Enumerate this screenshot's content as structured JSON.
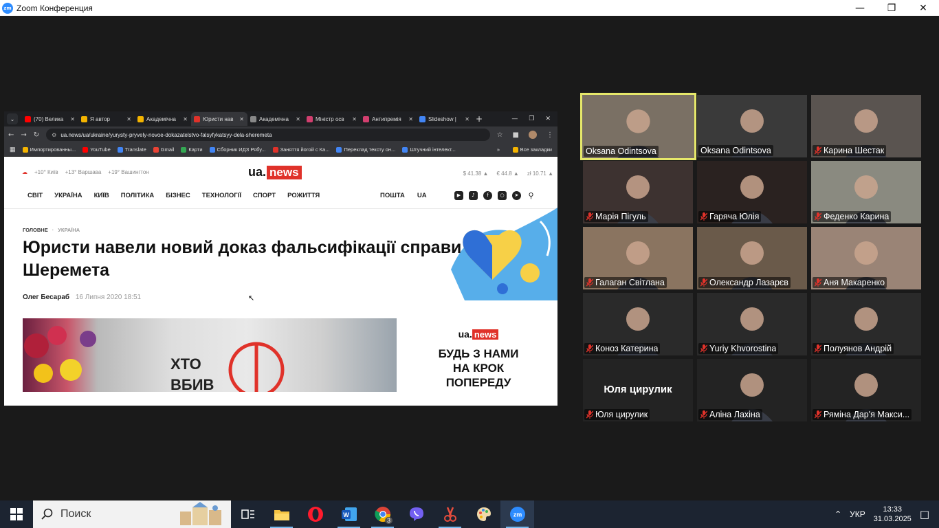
{
  "window": {
    "title": "Zoom Конференция",
    "logo_text": "zm"
  },
  "browser": {
    "tabs": [
      {
        "label": "(70) Велика",
        "color": "#ff0000"
      },
      {
        "label": "Я автор",
        "color": "#f4b400"
      },
      {
        "label": "Академічна",
        "color": "#f4b400"
      },
      {
        "label": "Юристи нав",
        "color": "#e0322a",
        "active": true
      },
      {
        "label": "Академічна",
        "color": "#888888"
      },
      {
        "label": "Міністр осв",
        "color": "#d23f6f"
      },
      {
        "label": "Антипремія",
        "color": "#d23f6f"
      },
      {
        "label": "Slideshow |",
        "color": "#4285f4"
      }
    ],
    "new_tab": "+",
    "url": "ua.news/ua/ukraine/yurysty-pryvely-novoe-dokazatelstvo-falsyfykatsyy-dela-sheremeta",
    "bookmarks": [
      {
        "label": "Импортированны...",
        "color": "#f4b400"
      },
      {
        "label": "YouTube",
        "color": "#ff0000"
      },
      {
        "label": "Translate",
        "color": "#4285f4"
      },
      {
        "label": "Gmail",
        "color": "#ea4335"
      },
      {
        "label": "Карти",
        "color": "#34a853"
      },
      {
        "label": "Сборник ИДЗ Рябу...",
        "color": "#4285f4"
      },
      {
        "label": "Заняття йогой с Ка...",
        "color": "#e0322a"
      },
      {
        "label": "Переклад тексту он...",
        "color": "#4285f4"
      },
      {
        "label": "Штучний інтелект...",
        "color": "#4285f4"
      }
    ],
    "bookmarks_more": "»",
    "all_bookmarks": "Все закладки"
  },
  "site": {
    "weather": [
      "+10° Київ",
      "+13° Варшава",
      "+19° Вашингтон"
    ],
    "logo_ua": "ua.",
    "logo_news": "news",
    "rates": [
      "$ 41.38 ▲",
      "€ 44.8 ▲",
      "zł 10.71 ▲"
    ],
    "nav": [
      "СВІТ",
      "УКРАЇНА",
      "КИЇВ",
      "ПОЛІТИКА",
      "БІЗНЕС",
      "ТЕХНОЛОГІЇ",
      "СПОРТ",
      "РОЖИТТЯ"
    ],
    "nav_right": [
      "ПОШТА",
      "UA"
    ],
    "social": [
      "youtube-icon",
      "tiktok-icon",
      "facebook-icon",
      "instagram-icon",
      "telegram-icon",
      "search-icon"
    ],
    "crumbs": [
      "ГОЛОВНЕ",
      "УКРАЇНА"
    ],
    "headline": "Юристи навели новий доказ фальсифікації справи Шеремета",
    "author": "Олег Бесараб",
    "date": "16 Липня 2020 18:51",
    "photo_text": "ХТО ВБИВ",
    "ad_slogan": "БУДЬ З НАМИ НА КРОК ПОПЕРЕДУ"
  },
  "participants": [
    {
      "name": "Oksana Odintsova",
      "muted": false,
      "speaking": true,
      "bg": "#7a7064"
    },
    {
      "name": "Oksana Odintsova",
      "muted": false,
      "speaking": false,
      "bg": "#3a3a3a"
    },
    {
      "name": "Карина Шестак",
      "muted": true,
      "speaking": false,
      "bg": "#5a5450"
    },
    {
      "name": "Марія Пігуль",
      "muted": true,
      "speaking": false,
      "bg": "#3d3230"
    },
    {
      "name": "Гаряча Юлія",
      "muted": true,
      "speaking": false,
      "bg": "#2a2220"
    },
    {
      "name": "Феденко Карина",
      "muted": true,
      "speaking": false,
      "bg": "#8a8a80"
    },
    {
      "name": "Галаган Світлана",
      "muted": true,
      "speaking": false,
      "bg": "#8a7460"
    },
    {
      "name": "Олександр Лазарєв",
      "muted": true,
      "speaking": false,
      "bg": "#6a5a4a"
    },
    {
      "name": "Аня Макаренко",
      "muted": true,
      "speaking": false,
      "bg": "#9a8476"
    },
    {
      "name": "Коноз Катерина",
      "muted": true,
      "speaking": false,
      "bg": "#2a2a2a"
    },
    {
      "name": "Yuriy Khvorostina",
      "muted": true,
      "speaking": false,
      "bg": "#2a2a2a"
    },
    {
      "name": "Полуянов Андрій",
      "muted": true,
      "speaking": false,
      "bg": "#2a2a2a"
    },
    {
      "name": "Юля цирулик",
      "muted": true,
      "speaking": false,
      "bg": "#232323",
      "display_text": "Юля цирулик"
    },
    {
      "name": "Аліна Лахіна",
      "muted": true,
      "speaking": false,
      "bg": "#232323"
    },
    {
      "name": "Ряміна Дар'я Макси...",
      "muted": true,
      "speaking": false,
      "bg": "#232323"
    }
  ],
  "taskbar": {
    "search_placeholder": "Поиск",
    "apps": [
      "task-view-icon",
      "file-explorer-icon",
      "opera-icon",
      "word-icon",
      "chrome-icon",
      "viber-icon",
      "snipping-icon",
      "paint-icon",
      "zoom-icon"
    ],
    "chrome_badge": "3",
    "language": "УКР",
    "time": "13:33",
    "date": "31.03.2025"
  }
}
